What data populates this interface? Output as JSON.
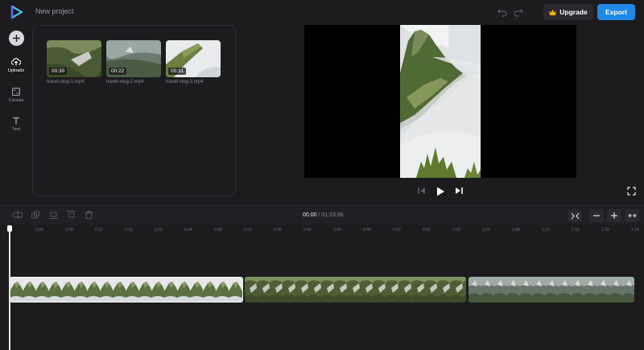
{
  "header": {
    "project_title": "New project",
    "upgrade_label": "Upgrade",
    "export_label": "Export"
  },
  "sidebar": {
    "items": [
      {
        "label": "Uploads",
        "icon": "upload-cloud-icon"
      },
      {
        "label": "Canvas",
        "icon": "canvas-icon"
      },
      {
        "label": "Text",
        "icon": "text-icon"
      }
    ]
  },
  "media": {
    "items": [
      {
        "duration": "00:30",
        "name": "travel-vlog-1.mp4"
      },
      {
        "duration": "00:22",
        "name": "travel-vlog-2.mp4"
      },
      {
        "duration": "00:31",
        "name": "travel-vlog-3.mp4"
      }
    ]
  },
  "timeline": {
    "current_time": "00.00",
    "separator": "/",
    "total_time": "01:23.96",
    "ticks": [
      "0",
      "0:04",
      "0:08",
      "0:12",
      "0:16",
      "0:20",
      "0:24",
      "0:28",
      "0:32",
      "0:36",
      "0:40",
      "0:44",
      "0:48",
      "0:52",
      "0:56",
      "1:00",
      "1:04",
      "1:08",
      "1:12",
      "1:16",
      "1:20",
      "1:24"
    ]
  },
  "colors": {
    "accent": "#1e88e5",
    "background": "#1c1c1f",
    "crown": "#f5b400"
  }
}
